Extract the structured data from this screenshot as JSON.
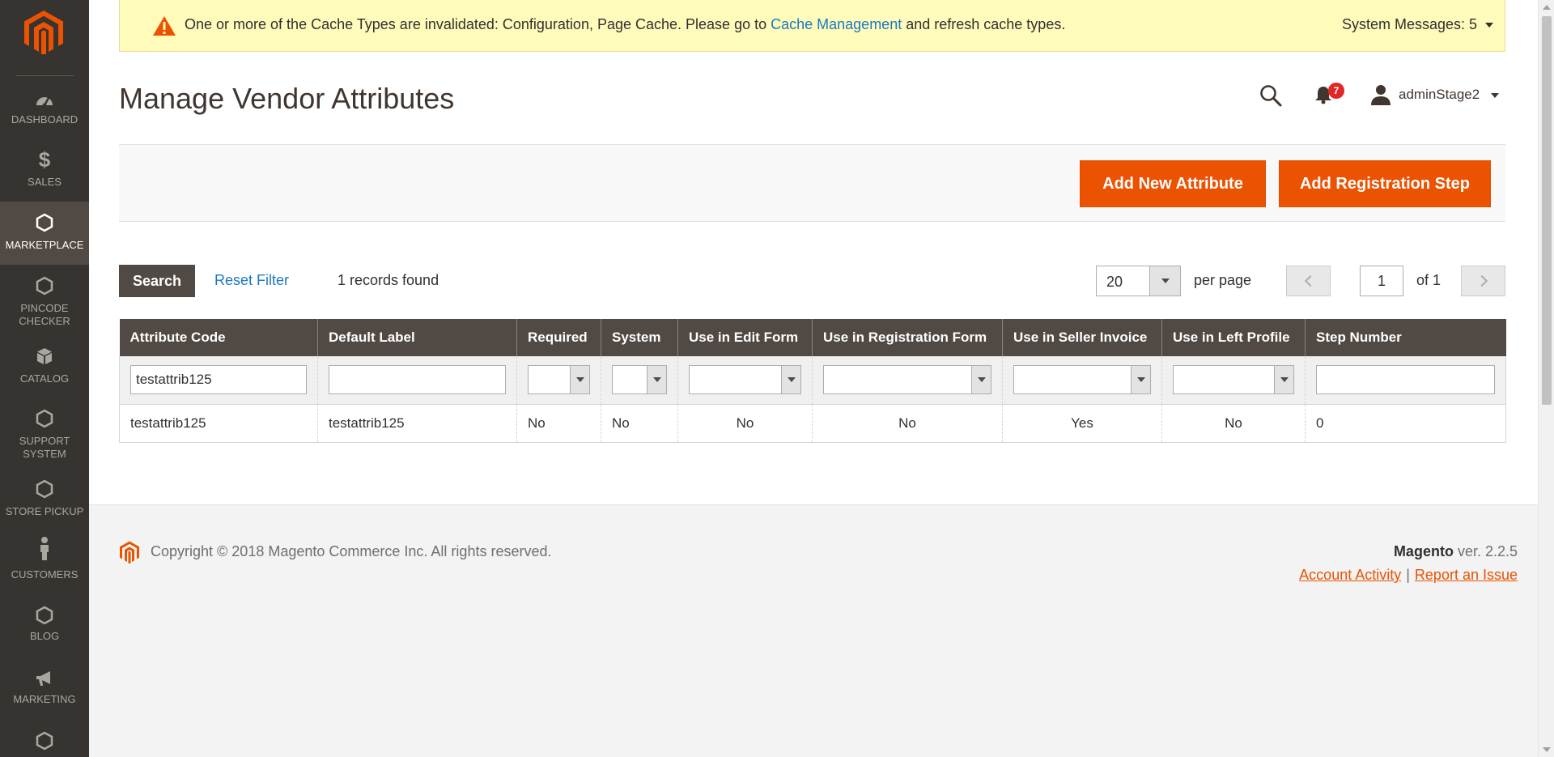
{
  "sidebar": {
    "logo_icon": "magento-logo-icon",
    "items": [
      {
        "label": "DASHBOARD",
        "icon": "speedometer-icon"
      },
      {
        "label": "SALES",
        "icon": "dollar-icon"
      },
      {
        "label": "MARKETPLACE",
        "icon": "hexagon-icon",
        "active": true
      },
      {
        "label": "PINCODE CHECKER",
        "icon": "hexagon-icon"
      },
      {
        "label": "CATALOG",
        "icon": "box-icon"
      },
      {
        "label": "SUPPORT SYSTEM",
        "icon": "hexagon-icon"
      },
      {
        "label": "STORE PICKUP",
        "icon": "hexagon-icon"
      },
      {
        "label": "CUSTOMERS",
        "icon": "person-icon"
      },
      {
        "label": "BLOG",
        "icon": "hexagon-icon"
      },
      {
        "label": "MARKETING",
        "icon": "megaphone-icon"
      },
      {
        "label": "",
        "icon": "hexagon-icon"
      }
    ]
  },
  "message": {
    "text_before": "One or more of the Cache Types are invalidated: Configuration, Page Cache. Please go to ",
    "link": "Cache Management",
    "text_after": " and refresh cache types.",
    "system_messages": "System Messages: 5"
  },
  "header": {
    "title": "Manage Vendor Attributes",
    "notifications_count": "7",
    "admin_user": "adminStage2"
  },
  "actions": {
    "add_attribute": "Add New Attribute",
    "add_step": "Add Registration Step"
  },
  "toolbar": {
    "search": "Search",
    "reset": "Reset Filter",
    "records": "1 records found",
    "per_page_value": "20",
    "per_page_label": "per page",
    "page_value": "1",
    "page_of": "of 1"
  },
  "grid": {
    "columns": [
      "Attribute Code",
      "Default Label",
      "Required",
      "System",
      "Use in Edit Form",
      "Use in Registration Form",
      "Use in Seller Invoice",
      "Use in Left Profile",
      "Step Number"
    ],
    "filters": {
      "attribute_code": "testattrib125"
    },
    "rows": [
      [
        "testattrib125",
        "testattrib125",
        "No",
        "No",
        "No",
        "No",
        "Yes",
        "No",
        "0"
      ]
    ]
  },
  "footer": {
    "copyright": "Copyright © 2018 Magento Commerce Inc. All rights reserved.",
    "brand": "Magento",
    "version": " ver. 2.2.5",
    "account_activity": "Account Activity",
    "separator": "|",
    "report_issue": "Report an Issue"
  },
  "colors": {
    "sidebar_bg": "#373330",
    "accent": "#eb5202",
    "header_row": "#514943",
    "link": "#1979c3",
    "message_bg": "#fffbbb"
  }
}
